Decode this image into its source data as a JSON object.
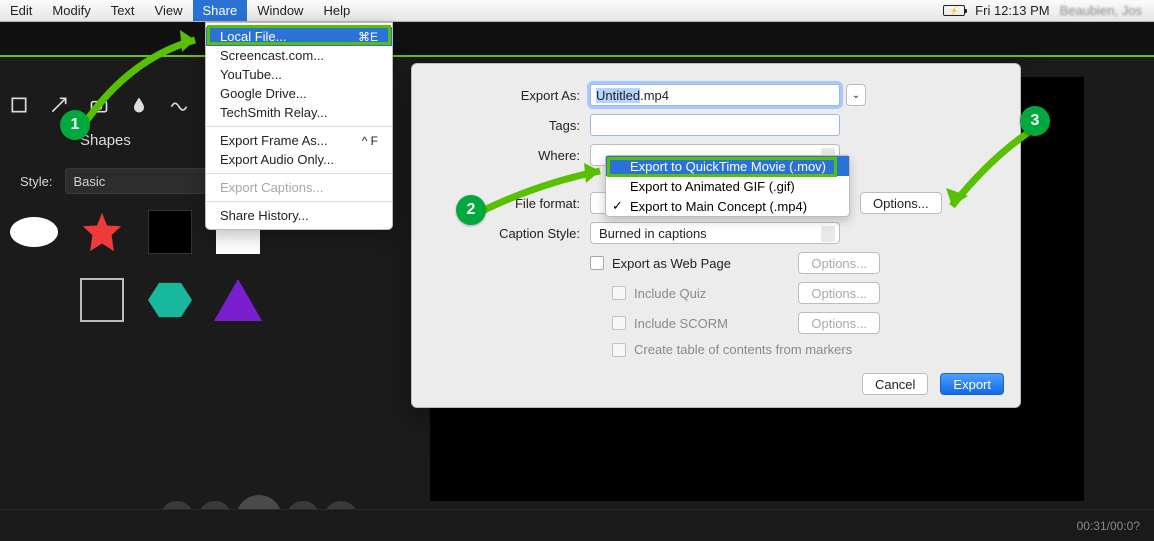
{
  "menubar": {
    "items": [
      "Edit",
      "Modify",
      "Text",
      "View",
      "Share",
      "Window",
      "Help"
    ],
    "active_index": 4,
    "clock": "Fri 12:13 PM",
    "username": "Beaubien, Jos",
    "battery_text": "⚡"
  },
  "window_title": "Untitled",
  "share_menu": {
    "items": [
      {
        "label": "Local File...",
        "shortcut": "⌘E",
        "selected": true
      },
      {
        "label": "Screencast.com..."
      },
      {
        "label": "YouTube..."
      },
      {
        "label": "Google Drive..."
      },
      {
        "label": "TechSmith Relay..."
      },
      {
        "sep": true
      },
      {
        "label": "Export Frame As...",
        "shortcut": "^ F"
      },
      {
        "label": "Export Audio Only..."
      },
      {
        "sep": true
      },
      {
        "label": "Export Captions...",
        "disabled": true
      },
      {
        "sep": true
      },
      {
        "label": "Share History..."
      }
    ]
  },
  "sidebar": {
    "panel_title": "Shapes",
    "style_label": "Style:",
    "style_value": "Basic"
  },
  "dialog": {
    "export_as_label": "Export As:",
    "export_as_value": "Untitled",
    "export_as_ext": ".mp4",
    "tags_label": "Tags:",
    "tags_value": "",
    "where_label": "Where:",
    "file_format_label": "File format:",
    "options_btn": "Options...",
    "caption_style_label": "Caption Style:",
    "caption_style_value": "Burned in captions",
    "webpage_label": "Export as Web Page",
    "include_quiz": "Include Quiz",
    "include_scorm": "Include SCORM",
    "toc": "Create table of contents from markers",
    "cancel": "Cancel",
    "export": "Export"
  },
  "format_dropdown": {
    "options": [
      {
        "label": "Export to QuickTime Movie (.mov)",
        "selected": true
      },
      {
        "label": "Export to Animated GIF (.gif)"
      },
      {
        "label": "Export to Main Concept (.mp4)",
        "checked": true
      }
    ]
  },
  "playbar": {
    "time": "00:31/00:0?"
  },
  "annotations": {
    "n1": "1",
    "n2": "2",
    "n3": "3"
  }
}
